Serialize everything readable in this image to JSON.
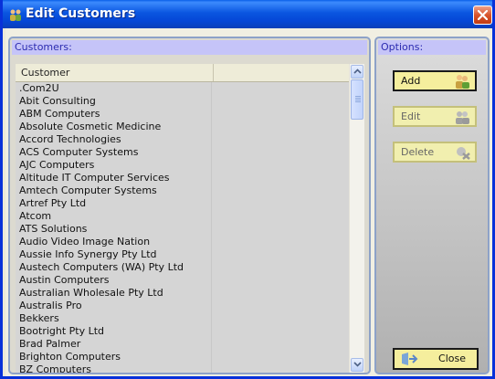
{
  "window": {
    "title": "Edit Customers"
  },
  "customers_panel": {
    "header": "Customers:",
    "column_header": "Customer",
    "rows": [
      ".Com2U",
      "Abit Consulting",
      "ABM Computers",
      "Absolute Cosmetic Medicine",
      "Accord Technologies",
      "ACS Computer Systems",
      "AJC Computers",
      "Altitude IT Computer Services",
      "Amtech Computer Systems",
      "Artref Pty Ltd",
      "Atcom",
      "ATS Solutions",
      "Audio Video Image Nation",
      "Aussie Info Synergy Pty Ltd",
      "Austech Computers (WA) Pty Ltd",
      "Austin Computers",
      "Australian Wholesale Pty Ltd",
      "Australis Pro",
      "Bekkers",
      "Bootright Pty Ltd",
      "Brad Palmer",
      "Brighton Computers",
      "BZ Computers"
    ]
  },
  "options_panel": {
    "header": "Options:",
    "add_label": "Add",
    "edit_label": "Edit",
    "delete_label": "Delete",
    "close_label": "Close"
  },
  "colors": {
    "title_bar": "#0a56e0",
    "panel_header_bg": "#c5c4f8",
    "panel_header_text": "#2b2bb0",
    "button_bg": "#f5ee9d",
    "close_button": "#d8542c"
  },
  "icons": {
    "app": "people-icon",
    "add": "add-person-icon",
    "edit": "edit-person-icon",
    "delete": "delete-icon",
    "close": "exit-door-icon"
  }
}
